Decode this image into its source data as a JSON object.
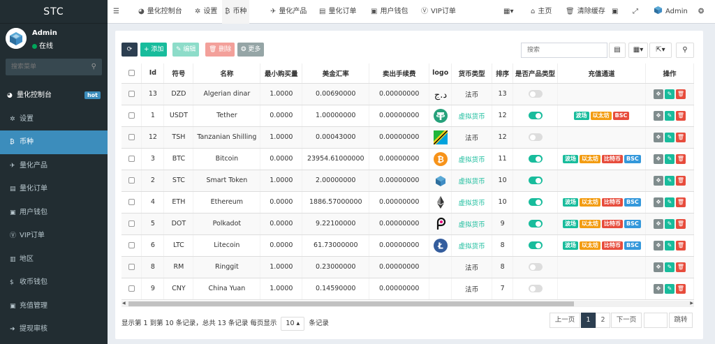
{
  "sidebar": {
    "brand": "STC",
    "user_name": "Admin",
    "user_status": "在线",
    "search_placeholder": "搜索菜单",
    "items": [
      {
        "label": "量化控制台",
        "icon": "dashboard-icon",
        "glyph": "◕",
        "badge": "hot"
      },
      {
        "label": "设置",
        "icon": "gear-icon",
        "glyph": "✲"
      },
      {
        "label": "币种",
        "icon": "bitcoin-icon",
        "glyph": "₿"
      },
      {
        "label": "量化产品",
        "icon": "plane-icon",
        "glyph": "✈"
      },
      {
        "label": "量化订单",
        "icon": "book-icon",
        "glyph": "▤"
      },
      {
        "label": "用户钱包",
        "icon": "money-icon",
        "glyph": "▣"
      },
      {
        "label": "VIP订单",
        "icon": "vimeo-icon",
        "glyph": "Ⓥ"
      },
      {
        "label": "地区",
        "icon": "map-icon",
        "glyph": "▥"
      },
      {
        "label": "收币钱包",
        "icon": "dollar-icon",
        "glyph": "$"
      },
      {
        "label": "充值管理",
        "icon": "money-icon",
        "glyph": "▣"
      },
      {
        "label": "提现审核",
        "icon": "arrow-circle-icon",
        "glyph": "➜"
      }
    ]
  },
  "topbar": {
    "tabs": [
      {
        "label": "量化控制台",
        "icon": "dashboard-icon",
        "glyph": "◕"
      },
      {
        "label": "设置",
        "icon": "gear-icon",
        "glyph": "✲"
      },
      {
        "label": "币种",
        "icon": "bitcoin-icon",
        "glyph": "₿"
      },
      {
        "label": "量化产品",
        "icon": "plane-icon",
        "glyph": "✈"
      },
      {
        "label": "量化订单",
        "icon": "book-icon",
        "glyph": "▤"
      },
      {
        "label": "用户钱包",
        "icon": "money-icon",
        "glyph": "▣"
      },
      {
        "label": "VIP订单",
        "icon": "vimeo-icon",
        "glyph": "Ⓥ"
      }
    ],
    "home": "主页",
    "clear_cache": "清除缓存",
    "admin": "Admin"
  },
  "toolbar": {
    "add": "添加",
    "edit": "编辑",
    "delete": "删除",
    "more": "更多",
    "search_placeholder": "搜索"
  },
  "table": {
    "columns": [
      "Id",
      "符号",
      "名称",
      "最小购买量",
      "美金汇率",
      "卖出手续费",
      "logo",
      "货币类型",
      "排序",
      "是否产品类型",
      "充值通道",
      "操作"
    ],
    "rows": [
      {
        "id": "13",
        "symbol": "DZD",
        "name": "Algerian dinar",
        "min_buy": "1.0000",
        "usd_rate": "0.00690000",
        "sell_fee": "0.00000000",
        "logo": "dzd",
        "type": "法币",
        "type_kind": "fiat",
        "sort": "13",
        "product": false,
        "channels": []
      },
      {
        "id": "1",
        "symbol": "USDT",
        "name": "Tether",
        "min_buy": "0.0000",
        "usd_rate": "1.00000000",
        "sell_fee": "0.00000000",
        "logo": "usdt",
        "type": "虚拟货币",
        "type_kind": "crypto",
        "sort": "12",
        "product": true,
        "channels": [
          "波场",
          "以太坊",
          "BSC"
        ]
      },
      {
        "id": "12",
        "symbol": "TSH",
        "name": "Tanzanian Shilling",
        "min_buy": "1.0000",
        "usd_rate": "0.00043000",
        "sell_fee": "0.00000000",
        "logo": "tsh",
        "type": "法币",
        "type_kind": "fiat",
        "sort": "12",
        "product": false,
        "channels": []
      },
      {
        "id": "3",
        "symbol": "BTC",
        "name": "Bitcoin",
        "min_buy": "0.0000",
        "usd_rate": "23954.61000000",
        "sell_fee": "0.00000000",
        "logo": "btc",
        "type": "虚拟货币",
        "type_kind": "crypto",
        "sort": "11",
        "product": true,
        "channels": [
          "波场",
          "以太坊",
          "比特币",
          "BSC"
        ]
      },
      {
        "id": "2",
        "symbol": "STC",
        "name": "Smart Token",
        "min_buy": "1.0000",
        "usd_rate": "2.00000000",
        "sell_fee": "0.00000000",
        "logo": "stc",
        "type": "虚拟货币",
        "type_kind": "crypto",
        "sort": "10",
        "product": true,
        "channels": []
      },
      {
        "id": "4",
        "symbol": "ETH",
        "name": "Ethereum",
        "min_buy": "0.0000",
        "usd_rate": "1886.57000000",
        "sell_fee": "0.00000000",
        "logo": "eth",
        "type": "虚拟货币",
        "type_kind": "crypto",
        "sort": "10",
        "product": true,
        "channels": [
          "波场",
          "以太坊",
          "比特币",
          "BSC"
        ]
      },
      {
        "id": "5",
        "symbol": "DOT",
        "name": "Polkadot",
        "min_buy": "0.0000",
        "usd_rate": "9.22100000",
        "sell_fee": "0.00000000",
        "logo": "dot",
        "type": "虚拟货币",
        "type_kind": "crypto",
        "sort": "9",
        "product": true,
        "channels": [
          "波场",
          "以太坊",
          "比特币",
          "BSC"
        ]
      },
      {
        "id": "6",
        "symbol": "LTC",
        "name": "Litecoin",
        "min_buy": "0.0000",
        "usd_rate": "61.73000000",
        "sell_fee": "0.00000000",
        "logo": "ltc",
        "type": "虚拟货币",
        "type_kind": "crypto",
        "sort": "8",
        "product": true,
        "channels": [
          "波场",
          "以太坊",
          "比特币",
          "BSC"
        ]
      },
      {
        "id": "8",
        "symbol": "RM",
        "name": "Ringgit",
        "min_buy": "1.0000",
        "usd_rate": "0.23000000",
        "sell_fee": "0.00000000",
        "logo": "",
        "type": "法币",
        "type_kind": "fiat",
        "sort": "8",
        "product": false,
        "channels": []
      },
      {
        "id": "9",
        "symbol": "CNY",
        "name": "China Yuan",
        "min_buy": "1.0000",
        "usd_rate": "0.14590000",
        "sell_fee": "0.00000000",
        "logo": "",
        "type": "法币",
        "type_kind": "fiat",
        "sort": "7",
        "product": false,
        "channels": []
      }
    ]
  },
  "footer": {
    "summary_pre": "显示第 1 到第 10 条记录，总共 13 条记录 每页显示",
    "page_size": "10",
    "summary_post": "条记录",
    "prev": "上一页",
    "next": "下一页",
    "page1": "1",
    "page2": "2",
    "jump": "跳转"
  },
  "colors": {
    "sidebar_bg": "#222d32",
    "active_blue": "#3c8dbc",
    "green": "#18bc9c",
    "red": "#e74c3c",
    "orange": "#f39c12",
    "blue": "#3498db"
  }
}
